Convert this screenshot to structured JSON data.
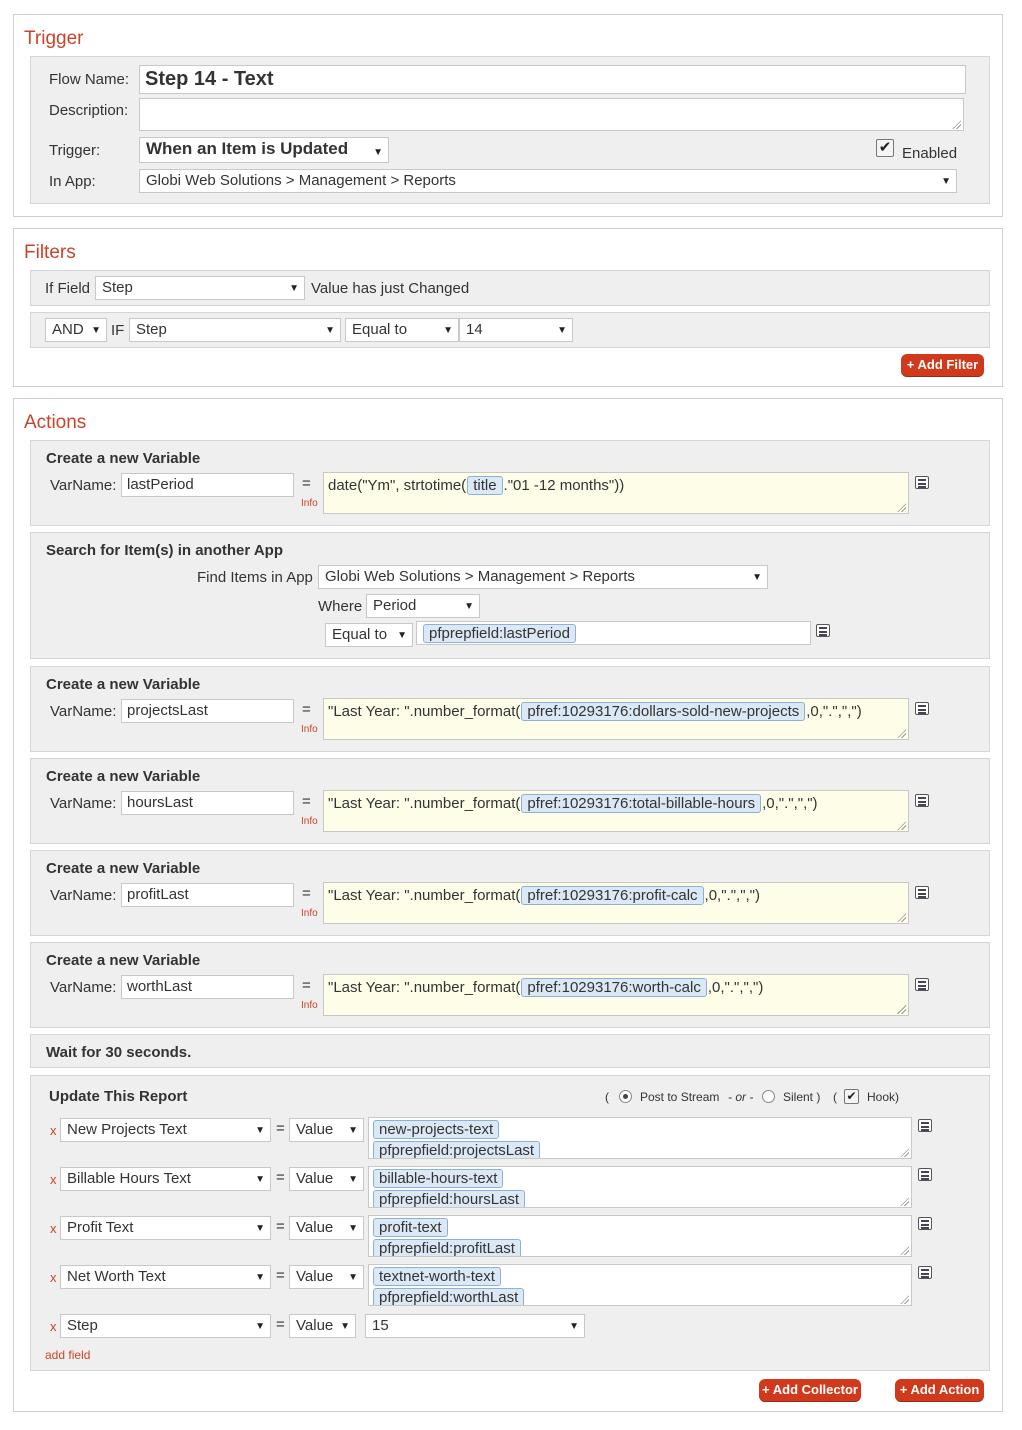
{
  "trigger": {
    "title": "Trigger",
    "flow_name_label": "Flow Name:",
    "flow_name_value": "Step 14 - Text",
    "description_label": "Description:",
    "description_value": "",
    "trigger_label": "Trigger:",
    "trigger_value": "When an Item is Updated",
    "enabled_label": "Enabled",
    "enabled_checked": true,
    "in_app_label": "In App:",
    "in_app_value": "Globi Web Solutions > Management > Reports"
  },
  "filters": {
    "title": "Filters",
    "if_field_label": "If Field",
    "if_field_value": "Step",
    "changed_label": "Value has just Changed",
    "and_value": "AND",
    "if_label": "IF",
    "field2_value": "Step",
    "operator_value": "Equal to",
    "compare_value": "14",
    "add_filter_label": "+ Add Filter"
  },
  "actions": {
    "title": "Actions",
    "var1": {
      "heading": "Create a new Variable",
      "varname_label": "VarName:",
      "varname": "lastPeriod",
      "eq": "=",
      "info": "Info",
      "expr_prefix": "date(\"Ym\", strtotime(",
      "expr_token": "title",
      "expr_suffix": ".\"01 -12 months\"))"
    },
    "search": {
      "heading": "Search for Item(s) in another App",
      "find_label": "Find Items in App",
      "find_value": "Globi Web Solutions > Management > Reports",
      "where_label": "Where",
      "where_value": "Period",
      "operator_value": "Equal to",
      "value_token": "pfprepfield:lastPeriod"
    },
    "var2": {
      "heading": "Create a new Variable",
      "varname_label": "VarName:",
      "varname": "projectsLast",
      "eq": "=",
      "info": "Info",
      "expr_prefix": "\"Last Year: \".number_format(",
      "expr_token": "pfref:10293176:dollars-sold-new-projects",
      "expr_suffix": ",0,\".\",\",\")"
    },
    "var3": {
      "heading": "Create a new Variable",
      "varname_label": "VarName:",
      "varname": "hoursLast",
      "eq": "=",
      "info": "Info",
      "expr_prefix": "\"Last Year: \".number_format(",
      "expr_token": "pfref:10293176:total-billable-hours",
      "expr_suffix": ",0,\".\",\",\")"
    },
    "var4": {
      "heading": "Create a new Variable",
      "varname_label": "VarName:",
      "varname": "profitLast",
      "eq": "=",
      "info": "Info",
      "expr_prefix": "\"Last Year: \".number_format(",
      "expr_token": "pfref:10293176:profit-calc",
      "expr_suffix": ",0,\".\",\",\")"
    },
    "var5": {
      "heading": "Create a new Variable",
      "varname_label": "VarName:",
      "varname": "worthLast",
      "eq": "=",
      "info": "Info",
      "expr_prefix": "\"Last Year: \".number_format(",
      "expr_token": "pfref:10293176:worth-calc",
      "expr_suffix": ",0,\".\",\",\")"
    },
    "wait": {
      "heading": "Wait for 30 seconds."
    },
    "update": {
      "heading": "Update This Report",
      "open_paren": "(",
      "post_label": "Post to Stream",
      "or_label": "- or -",
      "silent_label": "Silent )",
      "open_paren2": "(",
      "hook_label": "Hook)",
      "post_selected": true,
      "hook_checked": true,
      "rows": [
        {
          "x": "x",
          "field": "New Projects Text",
          "eq": "=",
          "mode": "Value",
          "token1": "new-projects-text",
          "token2": "pfprepfield:projectsLast"
        },
        {
          "x": "x",
          "field": "Billable Hours Text",
          "eq": "=",
          "mode": "Value",
          "token1": "billable-hours-text",
          "token2": "pfprepfield:hoursLast"
        },
        {
          "x": "x",
          "field": "Profit Text",
          "eq": "=",
          "mode": "Value",
          "token1": "profit-text",
          "token2": "pfprepfield:profitLast"
        },
        {
          "x": "x",
          "field": "Net Worth Text",
          "eq": "=",
          "mode": "Value",
          "token1": "textnet-worth-text",
          "token2": "pfprepfield:worthLast"
        }
      ],
      "step_row": {
        "x": "x",
        "field": "Step",
        "eq": "=",
        "mode": "Value",
        "value": "15"
      },
      "add_field_label": "add field"
    },
    "add_collector_label": "+ Add Collector",
    "add_action_label": "+ Add Action"
  },
  "icons": {
    "dropdown": "triangle-down-icon",
    "list": "list-picker-icon",
    "resize": "resize-grip-icon",
    "check": "checkmark-icon"
  },
  "colors": {
    "accent": "#c9442b",
    "button": "#d1391c",
    "panel": "#efefef",
    "expr_bg": "#fdfde8",
    "token_bg": "#dbe8f6"
  }
}
